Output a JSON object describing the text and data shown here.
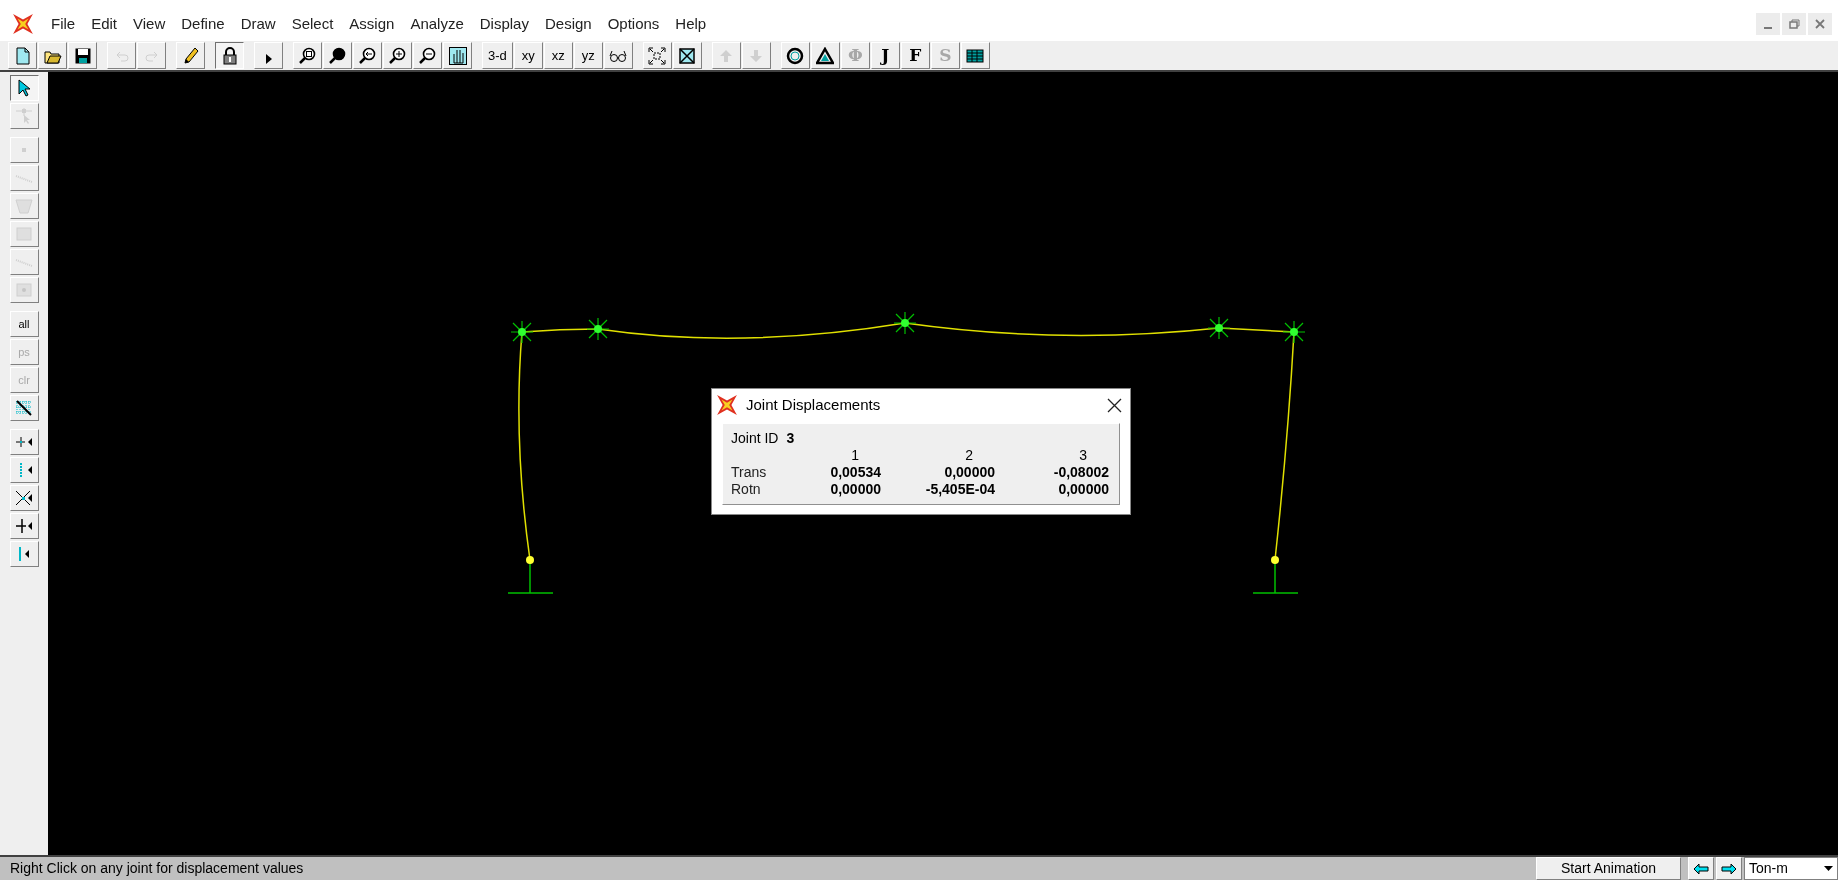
{
  "menu": [
    "File",
    "Edit",
    "View",
    "Define",
    "Draw",
    "Select",
    "Assign",
    "Analyze",
    "Display",
    "Design",
    "Options",
    "Help"
  ],
  "toolbar": {
    "groups": [
      [
        {
          "kind": "new",
          "disabled": false,
          "pressed": false
        },
        {
          "kind": "open",
          "disabled": false,
          "pressed": false
        },
        {
          "kind": "save",
          "disabled": false,
          "pressed": false
        }
      ],
      [
        {
          "kind": "undo",
          "disabled": true,
          "pressed": false
        },
        {
          "kind": "redo",
          "disabled": true,
          "pressed": false
        }
      ],
      [
        {
          "kind": "pencil",
          "disabled": false,
          "pressed": false
        }
      ],
      [
        {
          "kind": "lock",
          "disabled": false,
          "pressed": true
        }
      ],
      [
        {
          "kind": "play",
          "disabled": false,
          "pressed": false
        }
      ],
      [
        {
          "kind": "zoom-window",
          "disabled": false,
          "pressed": false
        },
        {
          "kind": "zoom-full",
          "disabled": false,
          "pressed": false
        },
        {
          "kind": "zoom-back",
          "disabled": false,
          "pressed": false
        },
        {
          "kind": "zoom-in",
          "disabled": false,
          "pressed": false
        },
        {
          "kind": "zoom-out",
          "disabled": false,
          "pressed": false
        },
        {
          "kind": "pan",
          "disabled": false,
          "pressed": false
        }
      ],
      [
        {
          "kind": "text",
          "label": "3-d",
          "disabled": false,
          "pressed": false
        },
        {
          "kind": "text",
          "label": "xy",
          "disabled": false,
          "pressed": false
        },
        {
          "kind": "text",
          "label": "xz",
          "disabled": false,
          "pressed": false
        },
        {
          "kind": "text",
          "label": "yz",
          "disabled": false,
          "pressed": false
        },
        {
          "kind": "glasses",
          "disabled": false,
          "pressed": false
        }
      ],
      [
        {
          "kind": "shrink",
          "disabled": false,
          "pressed": false
        },
        {
          "kind": "box-x",
          "disabled": false,
          "pressed": false
        }
      ],
      [
        {
          "kind": "up",
          "disabled": true,
          "pressed": false
        },
        {
          "kind": "down",
          "disabled": true,
          "pressed": false
        }
      ],
      [
        {
          "kind": "circle",
          "disabled": false,
          "pressed": false
        },
        {
          "kind": "triangle",
          "disabled": false,
          "pressed": false
        },
        {
          "kind": "text",
          "label": "Φ",
          "disabled": true,
          "pressed": false
        },
        {
          "kind": "text",
          "label": "J",
          "disabled": false,
          "pressed": false
        },
        {
          "kind": "text",
          "label": "F",
          "disabled": false,
          "pressed": false
        },
        {
          "kind": "text",
          "label": "S",
          "disabled": true,
          "pressed": false
        },
        {
          "kind": "table",
          "disabled": false,
          "pressed": false
        }
      ]
    ]
  },
  "side_toolbar": {
    "groups": [
      [
        {
          "kind": "pointer",
          "disabled": false,
          "pressed": true
        },
        {
          "kind": "joint-pointer",
          "disabled": true,
          "pressed": false
        }
      ],
      [
        {
          "kind": "dot",
          "disabled": true,
          "pressed": false
        },
        {
          "kind": "line",
          "disabled": true,
          "pressed": false
        },
        {
          "kind": "quad",
          "disabled": true,
          "pressed": false
        },
        {
          "kind": "rect",
          "disabled": true,
          "pressed": false
        },
        {
          "kind": "line",
          "disabled": true,
          "pressed": false
        },
        {
          "kind": "rect-dot",
          "disabled": true,
          "pressed": false
        }
      ],
      [
        {
          "kind": "text",
          "label": "all",
          "disabled": false,
          "pressed": false
        },
        {
          "kind": "text",
          "label": "ps",
          "disabled": true,
          "pressed": false
        },
        {
          "kind": "text",
          "label": "clr",
          "disabled": true,
          "pressed": false
        },
        {
          "kind": "hatch",
          "disabled": false,
          "pressed": false
        }
      ],
      [
        {
          "kind": "snap-point",
          "disabled": false,
          "pressed": false
        },
        {
          "kind": "snap-mid",
          "disabled": false,
          "pressed": false
        },
        {
          "kind": "snap-cross",
          "disabled": false,
          "pressed": false
        },
        {
          "kind": "snap-line",
          "disabled": false,
          "pressed": false
        },
        {
          "kind": "snap-end",
          "disabled": false,
          "pressed": false
        }
      ]
    ]
  },
  "dialog": {
    "title": "Joint Displacements",
    "joint_label": "Joint ID",
    "joint_id": "3",
    "columns": [
      "1",
      "2",
      "3"
    ],
    "rows": [
      {
        "label": "Trans",
        "values": [
          "0,00534",
          "0,00000",
          "-0,08002"
        ]
      },
      {
        "label": "Rotn",
        "values": [
          "0,00000",
          "-5,405E-04",
          "0,00000"
        ]
      }
    ]
  },
  "status_bar": {
    "message": "Right Click on any joint for displacement values",
    "animation_button": "Start Animation",
    "units": "Ton-m"
  }
}
